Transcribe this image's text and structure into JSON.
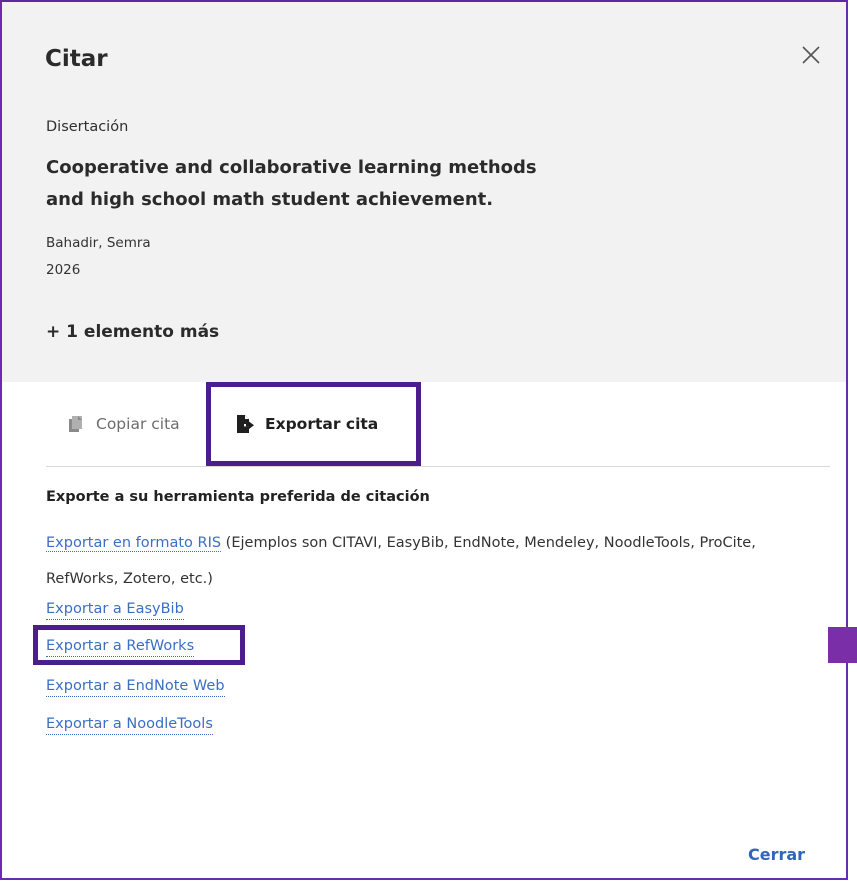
{
  "dialog": {
    "title": "Citar",
    "close_icon": "close-x-icon"
  },
  "record": {
    "type": "Disertación",
    "title_line1": "Cooperative and collaborative learning methods",
    "title_line2": "and high school math student achievement.",
    "author": "Bahadir, Semra",
    "year": "2026",
    "more_items": "+ 1 elemento más"
  },
  "tabs": [
    {
      "label": "Copiar cita",
      "icon": "copy-document-icon",
      "active": false
    },
    {
      "label": "Exportar cita",
      "icon": "export-document-icon",
      "active": true
    }
  ],
  "export": {
    "heading": "Exporte a su herramienta preferida de citación",
    "ris_link": "Exportar en formato RIS",
    "ris_description": " (Ejemplos son CITAVI, EasyBib, EndNote, Mendeley, NoodleTools, ProCite, RefWorks, Zotero, etc.)",
    "links": [
      "Exportar a EasyBib",
      "Exportar a RefWorks",
      "Exportar a EndNote Web",
      "Exportar a NoodleTools"
    ]
  },
  "footer": {
    "close_label": "Cerrar"
  },
  "colors": {
    "highlight_border": "#4b1d8e",
    "link": "#3a6fc4",
    "header_bg": "#f2f2f2"
  }
}
